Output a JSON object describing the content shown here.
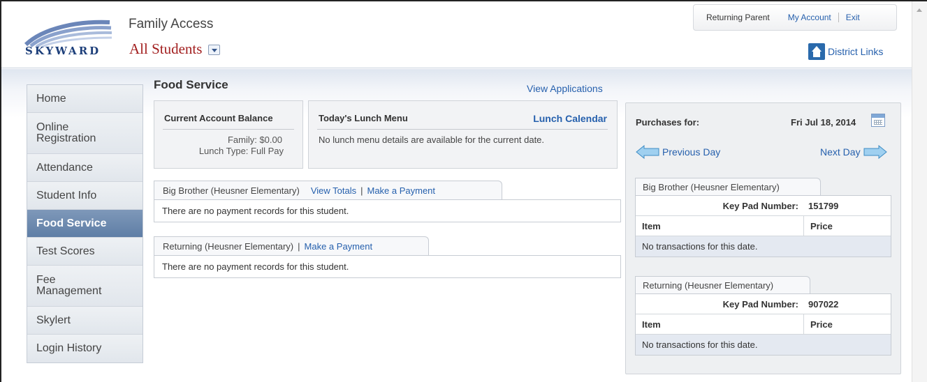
{
  "header": {
    "logo_text": "SKYWARD",
    "app_name": "Family Access",
    "student_selector": "All Students",
    "top_links": {
      "user": "Returning Parent",
      "account": "My Account",
      "exit": "Exit"
    },
    "district_links": "District Links"
  },
  "sidebar": {
    "items": [
      {
        "label": "Home",
        "active": false
      },
      {
        "label": "Online Registration",
        "active": false
      },
      {
        "label": "Attendance",
        "active": false
      },
      {
        "label": "Student Info",
        "active": false
      },
      {
        "label": "Food Service",
        "active": true
      },
      {
        "label": "Test Scores",
        "active": false
      },
      {
        "label": "Fee Management",
        "active": false
      },
      {
        "label": "Skylert",
        "active": false
      },
      {
        "label": "Login History",
        "active": false
      }
    ]
  },
  "main": {
    "title": "Food Service",
    "view_applications": "View Applications",
    "balance": {
      "title": "Current Account Balance",
      "family": "Family:  $0.00",
      "lunch_type": "Lunch Type:  Full Pay"
    },
    "menu": {
      "title": "Today's Lunch Menu",
      "calendar_link": "Lunch Calendar",
      "message": "No lunch menu details are available for the current date."
    },
    "students": [
      {
        "name": "Big Brother (Heusner Elementary)",
        "view_totals": "View Totals",
        "separator": "|",
        "make_payment": "Make a Payment",
        "records": "There are no payment records for this student."
      },
      {
        "name": "Returning (Heusner Elementary)",
        "separator": "|",
        "make_payment": "Make a Payment",
        "records": "There are no payment records for this student."
      }
    ]
  },
  "purchases": {
    "title": "Purchases for:",
    "date": "Fri Jul 18, 2014",
    "previous": "Previous Day",
    "next": "Next Day",
    "students": [
      {
        "name": "Big Brother (Heusner Elementary)",
        "keypad_label": "Key Pad Number:",
        "keypad_value": "151799",
        "col_item": "Item",
        "col_price": "Price",
        "empty": "No transactions for this date."
      },
      {
        "name": "Returning (Heusner Elementary)",
        "keypad_label": "Key Pad Number:",
        "keypad_value": "907022",
        "col_item": "Item",
        "col_price": "Price",
        "empty": "No transactions for this date."
      }
    ]
  },
  "colors": {
    "link": "#2660ad",
    "active_nav": "#6885ad",
    "student_selector": "#a21f1f"
  }
}
